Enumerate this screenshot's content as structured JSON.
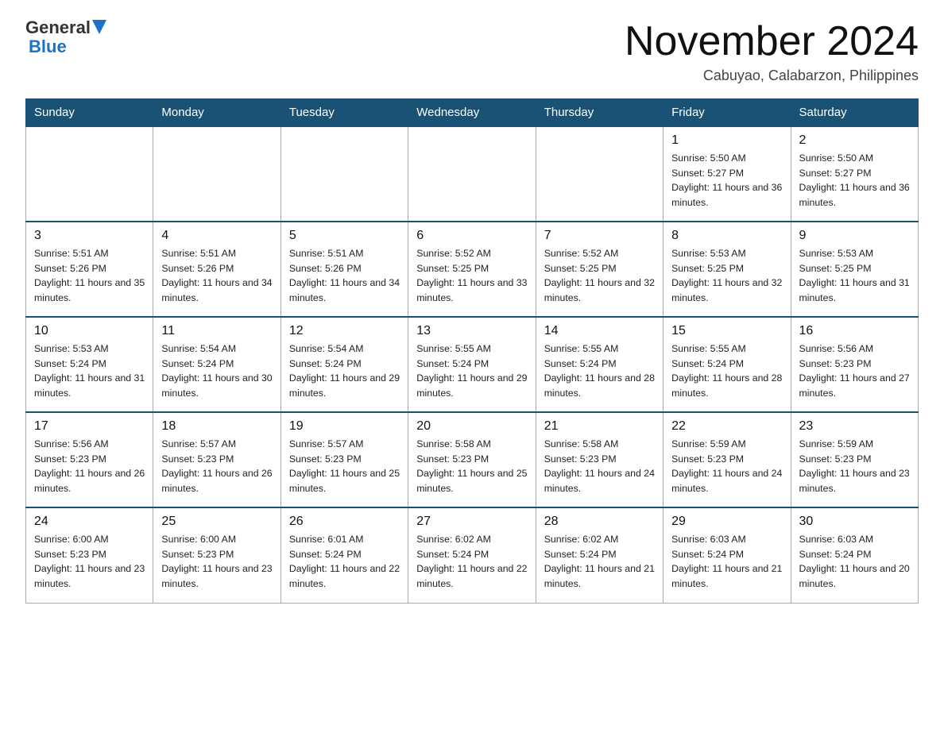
{
  "header": {
    "logo_general": "General",
    "logo_blue": "Blue",
    "month_title": "November 2024",
    "location": "Cabuyao, Calabarzon, Philippines"
  },
  "weekdays": [
    "Sunday",
    "Monday",
    "Tuesday",
    "Wednesday",
    "Thursday",
    "Friday",
    "Saturday"
  ],
  "weeks": [
    [
      {
        "day": "",
        "info": ""
      },
      {
        "day": "",
        "info": ""
      },
      {
        "day": "",
        "info": ""
      },
      {
        "day": "",
        "info": ""
      },
      {
        "day": "",
        "info": ""
      },
      {
        "day": "1",
        "info": "Sunrise: 5:50 AM\nSunset: 5:27 PM\nDaylight: 11 hours and 36 minutes."
      },
      {
        "day": "2",
        "info": "Sunrise: 5:50 AM\nSunset: 5:27 PM\nDaylight: 11 hours and 36 minutes."
      }
    ],
    [
      {
        "day": "3",
        "info": "Sunrise: 5:51 AM\nSunset: 5:26 PM\nDaylight: 11 hours and 35 minutes."
      },
      {
        "day": "4",
        "info": "Sunrise: 5:51 AM\nSunset: 5:26 PM\nDaylight: 11 hours and 34 minutes."
      },
      {
        "day": "5",
        "info": "Sunrise: 5:51 AM\nSunset: 5:26 PM\nDaylight: 11 hours and 34 minutes."
      },
      {
        "day": "6",
        "info": "Sunrise: 5:52 AM\nSunset: 5:25 PM\nDaylight: 11 hours and 33 minutes."
      },
      {
        "day": "7",
        "info": "Sunrise: 5:52 AM\nSunset: 5:25 PM\nDaylight: 11 hours and 32 minutes."
      },
      {
        "day": "8",
        "info": "Sunrise: 5:53 AM\nSunset: 5:25 PM\nDaylight: 11 hours and 32 minutes."
      },
      {
        "day": "9",
        "info": "Sunrise: 5:53 AM\nSunset: 5:25 PM\nDaylight: 11 hours and 31 minutes."
      }
    ],
    [
      {
        "day": "10",
        "info": "Sunrise: 5:53 AM\nSunset: 5:24 PM\nDaylight: 11 hours and 31 minutes."
      },
      {
        "day": "11",
        "info": "Sunrise: 5:54 AM\nSunset: 5:24 PM\nDaylight: 11 hours and 30 minutes."
      },
      {
        "day": "12",
        "info": "Sunrise: 5:54 AM\nSunset: 5:24 PM\nDaylight: 11 hours and 29 minutes."
      },
      {
        "day": "13",
        "info": "Sunrise: 5:55 AM\nSunset: 5:24 PM\nDaylight: 11 hours and 29 minutes."
      },
      {
        "day": "14",
        "info": "Sunrise: 5:55 AM\nSunset: 5:24 PM\nDaylight: 11 hours and 28 minutes."
      },
      {
        "day": "15",
        "info": "Sunrise: 5:55 AM\nSunset: 5:24 PM\nDaylight: 11 hours and 28 minutes."
      },
      {
        "day": "16",
        "info": "Sunrise: 5:56 AM\nSunset: 5:23 PM\nDaylight: 11 hours and 27 minutes."
      }
    ],
    [
      {
        "day": "17",
        "info": "Sunrise: 5:56 AM\nSunset: 5:23 PM\nDaylight: 11 hours and 26 minutes."
      },
      {
        "day": "18",
        "info": "Sunrise: 5:57 AM\nSunset: 5:23 PM\nDaylight: 11 hours and 26 minutes."
      },
      {
        "day": "19",
        "info": "Sunrise: 5:57 AM\nSunset: 5:23 PM\nDaylight: 11 hours and 25 minutes."
      },
      {
        "day": "20",
        "info": "Sunrise: 5:58 AM\nSunset: 5:23 PM\nDaylight: 11 hours and 25 minutes."
      },
      {
        "day": "21",
        "info": "Sunrise: 5:58 AM\nSunset: 5:23 PM\nDaylight: 11 hours and 24 minutes."
      },
      {
        "day": "22",
        "info": "Sunrise: 5:59 AM\nSunset: 5:23 PM\nDaylight: 11 hours and 24 minutes."
      },
      {
        "day": "23",
        "info": "Sunrise: 5:59 AM\nSunset: 5:23 PM\nDaylight: 11 hours and 23 minutes."
      }
    ],
    [
      {
        "day": "24",
        "info": "Sunrise: 6:00 AM\nSunset: 5:23 PM\nDaylight: 11 hours and 23 minutes."
      },
      {
        "day": "25",
        "info": "Sunrise: 6:00 AM\nSunset: 5:23 PM\nDaylight: 11 hours and 23 minutes."
      },
      {
        "day": "26",
        "info": "Sunrise: 6:01 AM\nSunset: 5:24 PM\nDaylight: 11 hours and 22 minutes."
      },
      {
        "day": "27",
        "info": "Sunrise: 6:02 AM\nSunset: 5:24 PM\nDaylight: 11 hours and 22 minutes."
      },
      {
        "day": "28",
        "info": "Sunrise: 6:02 AM\nSunset: 5:24 PM\nDaylight: 11 hours and 21 minutes."
      },
      {
        "day": "29",
        "info": "Sunrise: 6:03 AM\nSunset: 5:24 PM\nDaylight: 11 hours and 21 minutes."
      },
      {
        "day": "30",
        "info": "Sunrise: 6:03 AM\nSunset: 5:24 PM\nDaylight: 11 hours and 20 minutes."
      }
    ]
  ]
}
